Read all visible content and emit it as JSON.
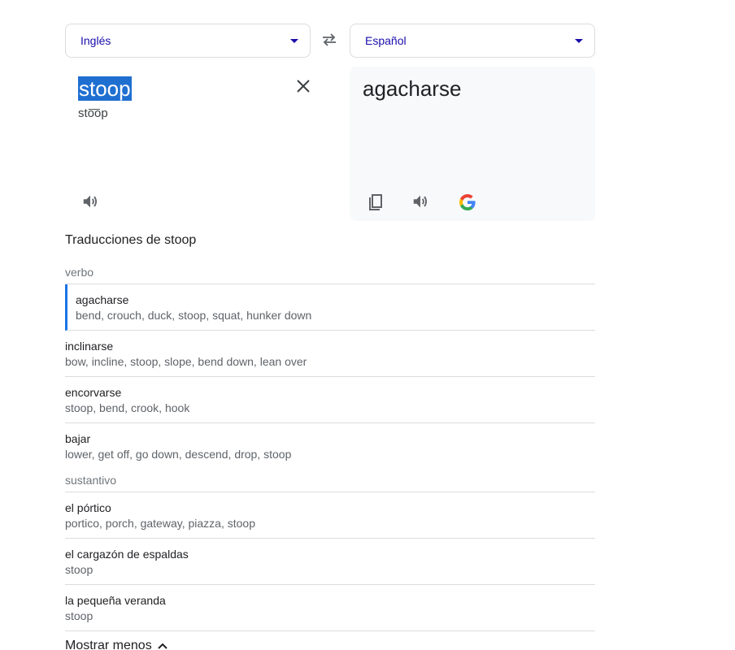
{
  "language_bar": {
    "source_language": "Inglés",
    "target_language": "Español",
    "swap_icon": "swap-arrows-icon"
  },
  "source": {
    "text": "stoop",
    "transliteration": "sto͞op",
    "clear_icon": "close-icon",
    "speaker_icon": "speaker-icon"
  },
  "target": {
    "text": "agacharse",
    "icons": [
      "copy-icon",
      "speaker-icon",
      "google-g-icon"
    ]
  },
  "translations": {
    "header": "Traducciones de stoop",
    "groups": [
      {
        "pos": "verbo",
        "entries": [
          {
            "word": "agacharse",
            "synonyms": "bend, crouch, duck, stoop, squat, hunker down"
          },
          {
            "word": "inclinarse",
            "synonyms": "bow, incline, stoop, slope, bend down, lean over"
          },
          {
            "word": "encorvarse",
            "synonyms": "stoop, bend, crook, hook"
          },
          {
            "word": "bajar",
            "synonyms": "lower, get off, go down, descend, drop, stoop"
          }
        ]
      },
      {
        "pos": "sustantivo",
        "entries": [
          {
            "word": "el pórtico",
            "synonyms": "portico, porch, gateway, piazza, stoop"
          },
          {
            "word": "el cargazón de espaldas",
            "synonyms": "stoop"
          },
          {
            "word": "la pequeña veranda",
            "synonyms": "stoop"
          }
        ]
      }
    ],
    "show_less": "Mostrar menos"
  },
  "colors": {
    "accent": "#1a73e8",
    "link": "#1a0dab",
    "selection": "#1f6fd1"
  }
}
